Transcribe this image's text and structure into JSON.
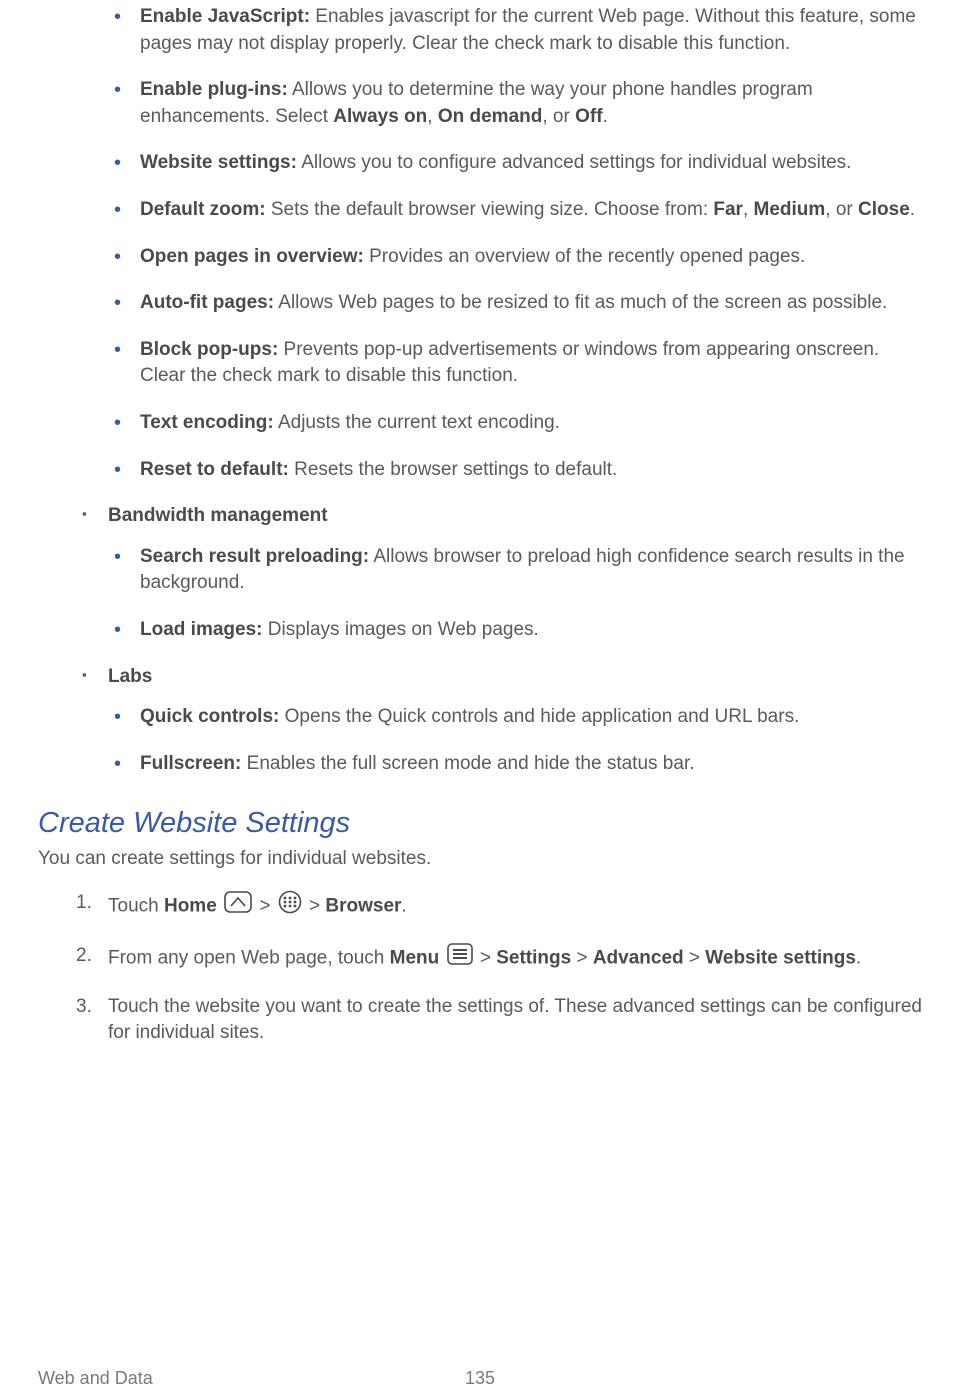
{
  "items_top": [
    {
      "label": "Enable JavaScript:",
      "desc": " Enables javascript for the current Web page. Without this feature, some pages may not display properly. Clear the check mark to disable this function."
    },
    {
      "label": "Enable plug-ins:",
      "desc_pre": " Allows you to determine the way your phone handles program enhancements. Select ",
      "opt1": "Always on",
      "sep1": ", ",
      "opt2": "On demand",
      "sep2": ", or ",
      "opt3": "Off",
      "tail": "."
    },
    {
      "label": "Website settings:",
      "desc": " Allows you to configure advanced settings for individual websites."
    },
    {
      "label": "Default zoom:",
      "desc_pre": " Sets the default browser viewing size. Choose from: ",
      "opt1": "Far",
      "sep1": ", ",
      "opt2": "Medium",
      "sep2": ", or ",
      "opt3": "Close",
      "tail": "."
    },
    {
      "label": "Open pages in overview:",
      "desc": " Provides an overview of the recently opened pages."
    },
    {
      "label": "Auto-fit pages:",
      "desc": " Allows Web pages to be resized to fit as much of the screen as possible."
    },
    {
      "label": "Block pop-ups:",
      "desc": " Prevents pop-up advertisements or windows from appearing onscreen. Clear the check mark to disable this function."
    },
    {
      "label": "Text encoding:",
      "desc": " Adjusts the current text encoding."
    },
    {
      "label": "Reset to default:",
      "desc": " Resets the browser settings to default."
    }
  ],
  "bandwidth": {
    "heading": "Bandwidth management",
    "items": [
      {
        "label": "Search result preloading:",
        "desc": " Allows browser to preload high confidence search results in the background."
      },
      {
        "label": "Load images:",
        "desc": " Displays images on Web pages."
      }
    ]
  },
  "labs": {
    "heading": "Labs",
    "items": [
      {
        "label": "Quick controls:",
        "desc": " Opens the Quick controls and hide application and URL bars."
      },
      {
        "label": "Fullscreen:",
        "desc": " Enables the full screen mode and hide the status bar."
      }
    ]
  },
  "section": {
    "title": "Create Website Settings",
    "intro": "You can create settings for individual websites."
  },
  "steps": {
    "s1": {
      "pre": "Touch ",
      "home": "Home",
      "gt1": " > ",
      "gt2": " > ",
      "browser": "Browser",
      "tail": "."
    },
    "s2": {
      "pre": "From any open Web page, touch ",
      "menu": "Menu",
      "gt": " > ",
      "settings": "Settings",
      "gt2": " > ",
      "advanced": "Advanced",
      "gt3": " > ",
      "website": "Website settings",
      "tail": "."
    },
    "s3": {
      "text": "Touch the website you want to create the settings of. These advanced settings can be configured for individual sites."
    }
  },
  "footer": {
    "left": "Web and Data",
    "page": "135"
  }
}
